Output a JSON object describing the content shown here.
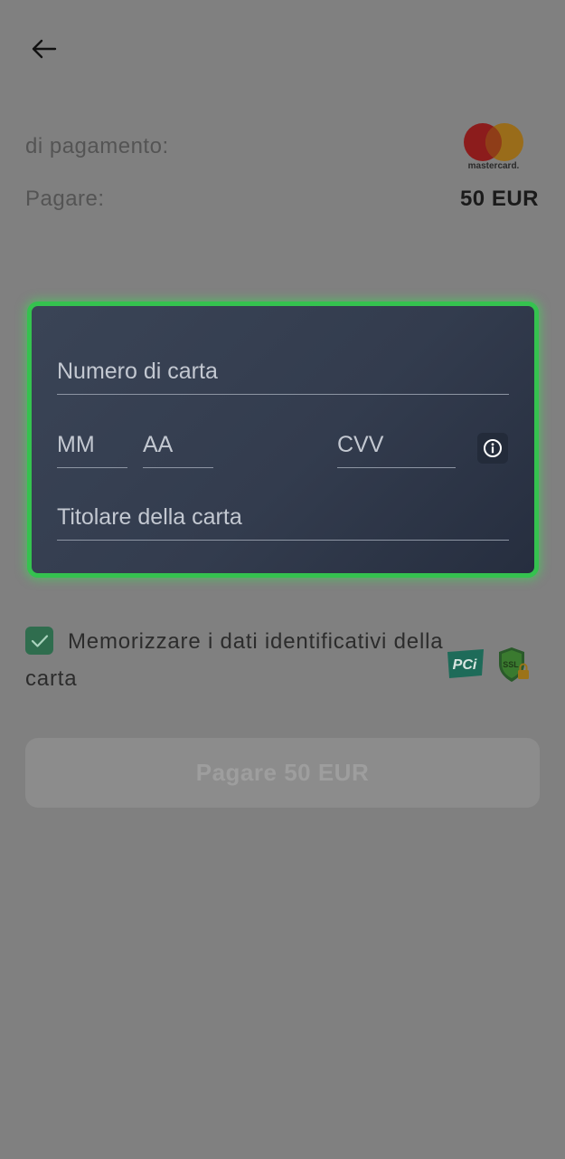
{
  "header": {
    "back_icon": "arrow-left-icon"
  },
  "summary": {
    "payment_method_label": "di pagamento:",
    "amount_label": "Pagare:",
    "amount_value": "50 EUR",
    "brand_logo_text": "mastercard."
  },
  "card_form": {
    "card_number_placeholder": "Numero di carta",
    "month_placeholder": "MM",
    "year_placeholder": "AA",
    "cvv_placeholder": "CVV",
    "holder_placeholder": "Titolare della carta",
    "cvv_info_icon": "info-icon",
    "border_color": "#35c24f"
  },
  "save_card": {
    "checked": true,
    "label": "Memorizzare i dati identificativi della carta"
  },
  "badges": {
    "pci": "PCi",
    "ssl": "SSL"
  },
  "pay_button": {
    "label": "Pagare 50 EUR",
    "enabled": false
  }
}
